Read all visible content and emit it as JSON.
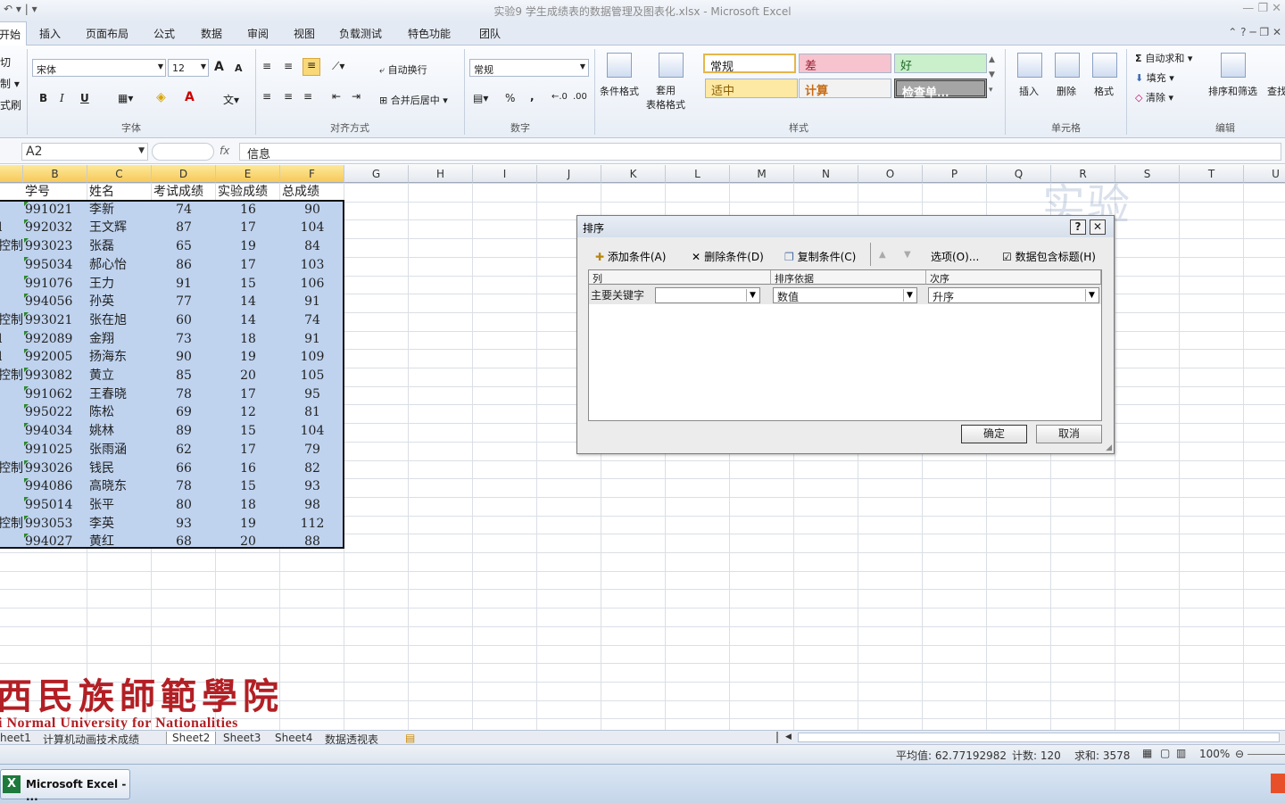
{
  "window": {
    "qat": "↶ ▾ | ▾",
    "title": "实验9  学生成绩表的数据管理及图表化.xlsx  -  Microsoft Excel",
    "controls": "— ❐ ✕"
  },
  "tabs": [
    "开始",
    "插入",
    "页面布局",
    "公式",
    "数据",
    "审阅",
    "视图",
    "负载测试",
    "特色功能",
    "团队"
  ],
  "tabs_right": "⌃ ? ─ ❐ ✕",
  "ribbon": {
    "clipboard": {
      "cut": "切",
      "copy": "制 ▾",
      "painter": "式刷"
    },
    "font": {
      "name": "宋体",
      "size": "12",
      "grow": "A",
      "shrink": "A",
      "bold": "B",
      "italic": "I",
      "underline": "U",
      "label": "字体"
    },
    "alignment": {
      "wrap": "自动换行",
      "merge": "合并后居中 ▾",
      "label": "对齐方式"
    },
    "number": {
      "format": "常规",
      "percent": "%",
      "comma": ",",
      "label": "数字"
    },
    "styles": {
      "conditional": "条件格式",
      "table": "套用\n表格格式",
      "cells": [
        "常规",
        "差",
        "好",
        "适中",
        "计算",
        "检查单..."
      ],
      "label": "样式"
    },
    "cells_group": {
      "insert": "插入",
      "delete": "删除",
      "format": "格式",
      "label": "单元格"
    },
    "editing": {
      "autosum": "自动求和 ▾",
      "fill": "填充 ▾",
      "clear": "清除 ▾",
      "sort": "排序和筛选",
      "find": "查找",
      "label": "编辑"
    }
  },
  "formula_bar": {
    "name_box": "A2",
    "fx": "fx",
    "content": "信息"
  },
  "columns": [
    "B",
    "C",
    "D",
    "E",
    "F",
    "G",
    "H",
    "I",
    "J",
    "K",
    "L",
    "M",
    "N",
    "O",
    "P",
    "Q",
    "R",
    "S",
    "T",
    "U"
  ],
  "table": {
    "headers": [
      "学号",
      "姓名",
      "考试成绩",
      "实验成绩",
      "总成绩"
    ],
    "rows": [
      {
        "a": "",
        "id": "991021",
        "name": "李新",
        "exam": 74,
        "lab": 16,
        "total": 90
      },
      {
        "a": "l",
        "id": "992032",
        "name": "王文辉",
        "exam": 87,
        "lab": 17,
        "total": 104
      },
      {
        "a": "控制",
        "id": "993023",
        "name": "张磊",
        "exam": 65,
        "lab": 19,
        "total": 84
      },
      {
        "a": "",
        "id": "995034",
        "name": "郝心怡",
        "exam": 86,
        "lab": 17,
        "total": 103
      },
      {
        "a": "",
        "id": "991076",
        "name": "王力",
        "exam": 91,
        "lab": 15,
        "total": 106
      },
      {
        "a": "",
        "id": "994056",
        "name": "孙英",
        "exam": 77,
        "lab": 14,
        "total": 91
      },
      {
        "a": "控制",
        "id": "993021",
        "name": "张在旭",
        "exam": 60,
        "lab": 14,
        "total": 74
      },
      {
        "a": "l",
        "id": "992089",
        "name": "金翔",
        "exam": 73,
        "lab": 18,
        "total": 91
      },
      {
        "a": "l",
        "id": "992005",
        "name": "扬海东",
        "exam": 90,
        "lab": 19,
        "total": 109
      },
      {
        "a": "控制",
        "id": "993082",
        "name": "黄立",
        "exam": 85,
        "lab": 20,
        "total": 105
      },
      {
        "a": "",
        "id": "991062",
        "name": "王春晓",
        "exam": 78,
        "lab": 17,
        "total": 95
      },
      {
        "a": "",
        "id": "995022",
        "name": "陈松",
        "exam": 69,
        "lab": 12,
        "total": 81
      },
      {
        "a": "",
        "id": "994034",
        "name": "姚林",
        "exam": 89,
        "lab": 15,
        "total": 104
      },
      {
        "a": "",
        "id": "991025",
        "name": "张雨涵",
        "exam": 62,
        "lab": 17,
        "total": 79
      },
      {
        "a": "控制",
        "id": "993026",
        "name": "钱民",
        "exam": 66,
        "lab": 16,
        "total": 82
      },
      {
        "a": "",
        "id": "994086",
        "name": "高晓东",
        "exam": 78,
        "lab": 15,
        "total": 93
      },
      {
        "a": "",
        "id": "995014",
        "name": "张平",
        "exam": 80,
        "lab": 18,
        "total": 98
      },
      {
        "a": "控制",
        "id": "993053",
        "name": "李英",
        "exam": 93,
        "lab": 19,
        "total": 112
      },
      {
        "a": "",
        "id": "994027",
        "name": "黄红",
        "exam": 68,
        "lab": 20,
        "total": 88
      }
    ]
  },
  "dialog": {
    "title": "排序",
    "help": "?",
    "close": "✕",
    "add_level": "添加条件(A)",
    "delete_level": "删除条件(D)",
    "copy_level": "复制条件(C)",
    "up": "▲",
    "down": "▼",
    "options": "选项(O)...",
    "has_headers_label": "数据包含标题(H)",
    "has_headers_checked": true,
    "col_headers": [
      "列",
      "排序依据",
      "次序"
    ],
    "row_label": "主要关键字",
    "column_value": "",
    "sort_on": "数值",
    "order": "升序",
    "ok": "确定",
    "cancel": "取消"
  },
  "sheets": [
    "heet1",
    "计算机动画技术成绩",
    "Sheet2",
    "Sheet3",
    "Sheet4",
    "数据透视表"
  ],
  "active_sheet": "Sheet2",
  "status": {
    "average": "平均值: 62.77192982",
    "count": "计数: 120",
    "sum": "求和: 3578",
    "zoom": "100%"
  },
  "taskbar": {
    "app": "Microsoft Excel - ..."
  },
  "overlay": {
    "watermark": "实验",
    "logo_cn": "西民族師範學院",
    "logo_en": "i Normal University for Nationalities"
  },
  "colors": {
    "selection": "#bfd3ef",
    "header_sel": "#f7c95a",
    "logo": "#b21f24"
  }
}
